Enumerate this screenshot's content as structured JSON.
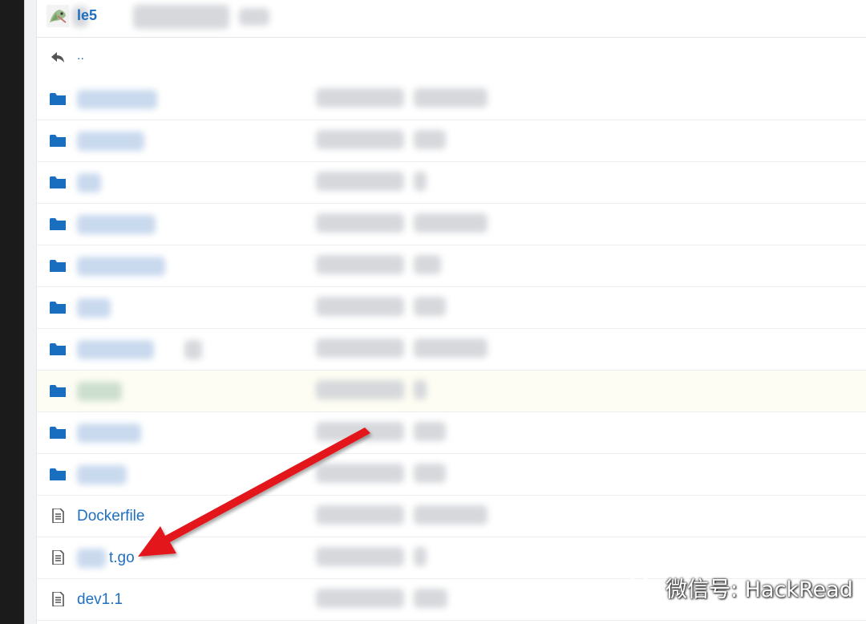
{
  "header": {
    "repo_name": "le5"
  },
  "parent_row": {
    "label": ".."
  },
  "files": [
    {
      "name": "Dockerfile",
      "type": "file"
    },
    {
      "name": "t.go",
      "type": "file"
    },
    {
      "name": "dev1.1",
      "type": "file"
    }
  ],
  "folder_rows_count_visible": 10,
  "watermark": {
    "text": "微信号: HackRead"
  },
  "colors": {
    "link": "#1f6fc1",
    "folder_icon": "#1a6ec0",
    "arrow": "#e3191b",
    "highlight_row": "#fdfdf3"
  },
  "icons": {
    "avatar": "repo-avatar-icon",
    "back": "reply-arrow-icon",
    "folder": "folder-icon",
    "file": "file-text-icon",
    "watermark": "wechat-logo-icon"
  }
}
